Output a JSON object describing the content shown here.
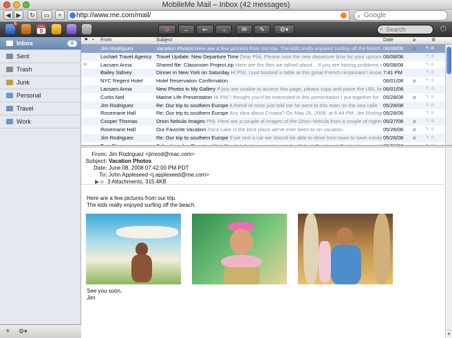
{
  "window": {
    "title": "MobileMe Mail – Inbox (42 messages)"
  },
  "browser": {
    "back": "◀",
    "forward": "▶",
    "reload": "↻",
    "add": "+",
    "url": "http://www.me.com/mail/",
    "search_placeholder": "Google"
  },
  "apps": {
    "mail_badge": "6",
    "calendar_month": "MON",
    "calendar_day": "9"
  },
  "mail_toolbar": {
    "search_placeholder": "Search"
  },
  "sidebar": {
    "folders": [
      {
        "label": "Inbox",
        "count": "6",
        "color": "#ffffff"
      },
      {
        "label": "Sent",
        "color": "#7f8ea4"
      },
      {
        "label": "Trash",
        "color": "#8c8c8c"
      },
      {
        "label": "Junk",
        "color": "#c89b2b"
      },
      {
        "label": "Personal",
        "color": "#6c95c9"
      },
      {
        "label": "Travel",
        "color": "#6c95c9"
      },
      {
        "label": "Work",
        "color": "#6c95c9"
      }
    ]
  },
  "list": {
    "columns": {
      "from": "From",
      "subject": "Subject",
      "date": "Date"
    },
    "rows": [
      {
        "from": "Jim Rodriguez",
        "subject": "Vacation Photos",
        "preview": "Here are a few pictures from our trip. The kids really enjoyed surfing off the beach.",
        "date": "06/08/08",
        "attach": true,
        "selected": true
      },
      {
        "from": "Lochart Travel Agency",
        "subject": "Travel Update: New Departure Time",
        "preview": "Dear Phil, Please note the new departure time for your upcoming",
        "date": "06/08/08"
      },
      {
        "from": "Lacsam Anna",
        "subject": "Shared file: Classroom Project.zip",
        "preview": "Here are the files we talked about... If you are having problems a",
        "date": "06/08/08",
        "flag": true
      },
      {
        "from": "Bailey Sidney",
        "subject": "Dinner in New York on Saturday",
        "preview": "Hi Phil, I just booked a table at this great French restaurant I know",
        "date": "7:41 PM"
      },
      {
        "from": "NYC Regent Hotel",
        "subject": "Hotel Reservation Confirmation",
        "preview": "",
        "date": "06/01/08",
        "attach": true
      },
      {
        "from": "Lacsam Anna",
        "subject": "New Photos in My Gallery",
        "preview": "If you are unable to access this page, please copy and paste the URL below",
        "date": "06/01/08"
      },
      {
        "from": "Curtis Neil",
        "subject": "Marine Life Presentation",
        "preview": "Hi Phil I thought you'd be interested in this presentation I put together for",
        "date": "05/28/08",
        "attach": true
      },
      {
        "from": "Jim Rodriguez",
        "subject": "Re: Our trip to southern Europe",
        "preview": "A friend of mine just told me he went to this town on the sea calle",
        "date": "05/28/08"
      },
      {
        "from": "Rosemarie Hall",
        "subject": "Re: Our trip to southern Europe",
        "preview": "Any idea about Croatia? On May 26, 2008, at 6:44 PM, Jim Rodriguez wrote",
        "date": "05/28/08"
      },
      {
        "from": "Cooper Thomas",
        "subject": "Orion Nebula Images",
        "preview": "Phil, Here are a couple of images of the Orion Nebula from a couple of nights",
        "date": "05/27/08",
        "attach": true
      },
      {
        "from": "Rosemarie Hall",
        "subject": "Our Favorite Vacation",
        "preview": "Zaca Lake is the best place we've ever been to on vacation.",
        "date": "05/26/08",
        "attach": true
      },
      {
        "from": "Jim Rodriguez",
        "subject": "Re: Our trip to southern Europe",
        "preview": "If we rent a car we should be able to drive from town to town easily",
        "date": "05/26/08",
        "attach": true
      },
      {
        "from": "Toni Chavez",
        "subject": "School garden Pics",
        "preview": "Hey Phil, The kids had a great time at the School Garden :-) Too bad you could",
        "date": "05/26/08",
        "attach": true
      }
    ]
  },
  "message": {
    "labels": {
      "from": "From:",
      "subject": "Subject:",
      "date": "Date:",
      "to": "To:"
    },
    "from": "Jim Rodriguez <jimrod@mac.com>",
    "subject": "Vacation Photos",
    "date": "June 08, 2008 07:42:00 PM PDT",
    "to": "John Appleseed <j.appleseed@me.com>",
    "attachments": "3 Attachments, 315.4KB",
    "body_line_1": "Here are a few pictures from our trip.",
    "body_line_2": "The kids really enjoyed surfing off the beach.",
    "signoff_1": "See you soon,",
    "signoff_2": "Jim"
  }
}
